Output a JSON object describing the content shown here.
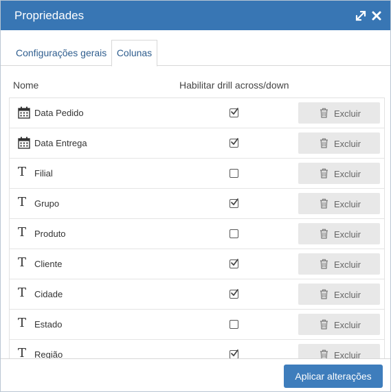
{
  "dialog": {
    "title": "Propriedades"
  },
  "tabs": [
    {
      "label": "Configurações gerais",
      "active": false
    },
    {
      "label": "Colunas",
      "active": true
    }
  ],
  "columns_header": {
    "name": "Nome",
    "drill": "Habilitar drill across/down"
  },
  "rows": [
    {
      "name": "Data Pedido",
      "type": "calendar-icon",
      "drill": true
    },
    {
      "name": "Data Entrega",
      "type": "calendar-icon",
      "drill": true
    },
    {
      "name": "Filial",
      "type": "text-type-icon",
      "drill": false
    },
    {
      "name": "Grupo",
      "type": "text-type-icon",
      "drill": true
    },
    {
      "name": "Produto",
      "type": "text-type-icon",
      "drill": false
    },
    {
      "name": "Cliente",
      "type": "text-type-icon",
      "drill": true
    },
    {
      "name": "Cidade",
      "type": "text-type-icon",
      "drill": true
    },
    {
      "name": "Estado",
      "type": "text-type-icon",
      "drill": false
    },
    {
      "name": "Região",
      "type": "text-type-icon",
      "drill": true
    }
  ],
  "delete_label": "Excluir",
  "text_type_glyph": "T",
  "apply_label": "Aplicar alterações",
  "colors": {
    "titlebar": "#3876b4",
    "apply_button": "#3e7dbc",
    "tab_text": "#2e5d8e"
  }
}
